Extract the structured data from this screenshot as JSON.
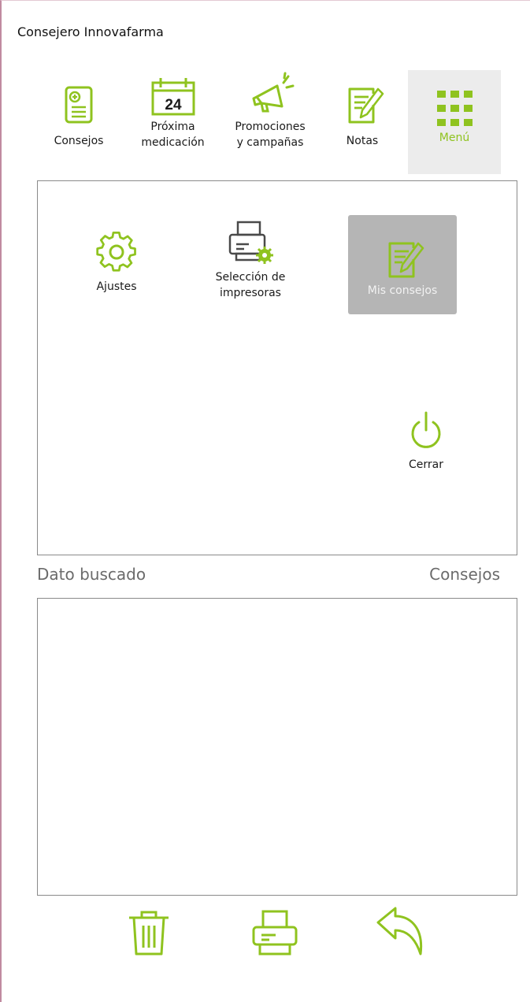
{
  "window": {
    "title": "Consejero Innovafarma"
  },
  "tabs": [
    {
      "id": "consejos",
      "label": "Consejos"
    },
    {
      "id": "proxima",
      "label": "Próxima\nmedicación",
      "calendar_day": "24"
    },
    {
      "id": "promociones",
      "label": "Promociones\ny campañas"
    },
    {
      "id": "notas",
      "label": "Notas"
    },
    {
      "id": "menu",
      "label": "Menú",
      "active": true
    }
  ],
  "menu": {
    "items": [
      {
        "id": "ajustes",
        "label": "Ajustes"
      },
      {
        "id": "impresoras",
        "label": "Selección de\nimpresoras"
      },
      {
        "id": "mis_consejos",
        "label": "Mis consejos",
        "selected": true
      },
      {
        "id": "cerrar",
        "label": "Cerrar"
      }
    ]
  },
  "search": {
    "dato_label": "Dato buscado",
    "consejos_label": "Consejos"
  },
  "bottom_actions": [
    {
      "id": "delete",
      "icon": "trash-icon"
    },
    {
      "id": "print",
      "icon": "printer-icon"
    },
    {
      "id": "back",
      "icon": "undo-arrow-icon"
    }
  ],
  "colors": {
    "accent": "#8fc31f",
    "selected_bg": "#b5b5b5",
    "active_tab_bg": "#ececec"
  }
}
